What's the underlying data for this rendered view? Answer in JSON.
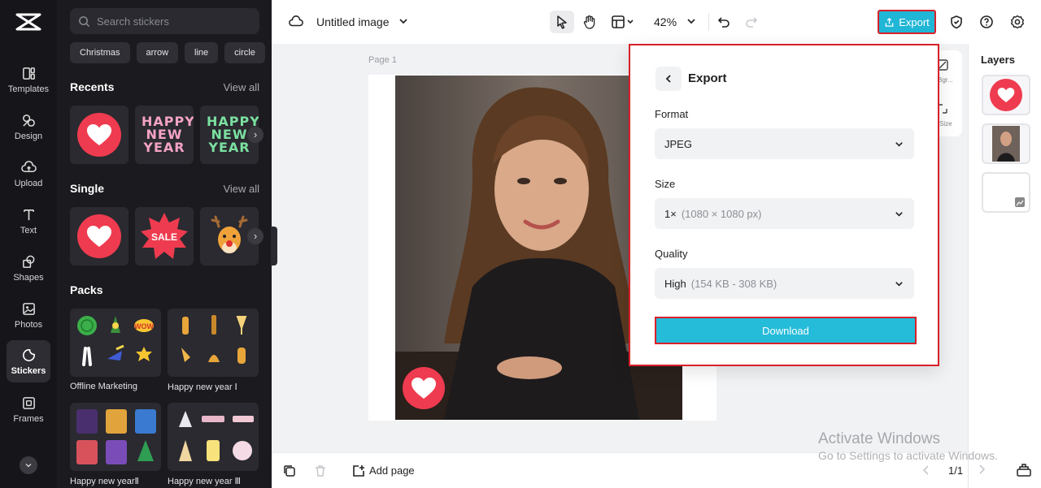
{
  "rail": {
    "items": [
      {
        "label": "Templates",
        "icon": "templates-icon"
      },
      {
        "label": "Design",
        "icon": "design-icon"
      },
      {
        "label": "Upload",
        "icon": "upload-icon"
      },
      {
        "label": "Text",
        "icon": "text-icon"
      },
      {
        "label": "Shapes",
        "icon": "shapes-icon"
      },
      {
        "label": "Photos",
        "icon": "photos-icon"
      },
      {
        "label": "Stickers",
        "icon": "stickers-icon",
        "active": true
      },
      {
        "label": "Frames",
        "icon": "frames-icon"
      }
    ]
  },
  "panel": {
    "search_placeholder": "Search stickers",
    "chips": [
      "Christmas",
      "arrow",
      "line",
      "circle"
    ],
    "recents": {
      "title": "Recents",
      "view_all": "View all",
      "hny_text_1": "HAPPY NEW YEAR",
      "hny_text_2": "HAPPY NEW YEAR"
    },
    "single": {
      "title": "Single",
      "view_all": "View all",
      "sale_text": "SALE"
    },
    "packs": {
      "title": "Packs",
      "items": [
        {
          "label": "Offline Marketing"
        },
        {
          "label": "Happy new year Ⅰ"
        },
        {
          "label": "Happy new yearⅡ"
        },
        {
          "label": "Happy new year Ⅲ"
        }
      ],
      "wow_text": "WOW"
    }
  },
  "topbar": {
    "title": "Untitled image",
    "zoom": "42%",
    "export_label": "Export"
  },
  "canvas": {
    "page_label": "Page 1"
  },
  "side_tools": {
    "tool1": "Bgr...",
    "tool2": "Size"
  },
  "layers": {
    "title": "Layers"
  },
  "export_modal": {
    "title": "Export",
    "format_label": "Format",
    "format_value": "JPEG",
    "size_label": "Size",
    "size_value": "1×",
    "size_detail": "(1080 × 1080 px)",
    "quality_label": "Quality",
    "quality_value": "High",
    "quality_detail": "(154 KB - 308 KB)",
    "download_label": "Download"
  },
  "bottombar": {
    "add_page": "Add page",
    "page_counter": "1/1"
  },
  "watermark": {
    "line1": "Activate Windows",
    "line2": "Go to Settings to activate Windows."
  },
  "colors": {
    "accent": "#20b6d6",
    "highlight_border": "#d8202a",
    "heart_red": "#ef3b4f",
    "rail_bg": "#16161a",
    "panel_bg": "#1b1b1f"
  }
}
